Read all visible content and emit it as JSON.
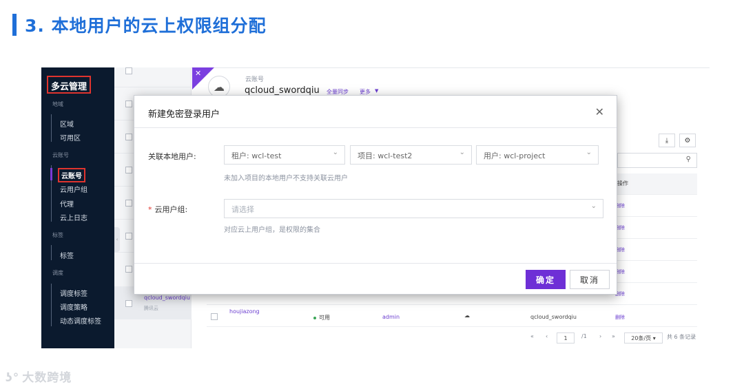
{
  "slide": {
    "title": "3. 本地用户的云上权限组分配"
  },
  "sidebar": {
    "brand": "多云管理",
    "groups": [
      {
        "label": "地域",
        "items": [
          "区域",
          "可用区"
        ]
      },
      {
        "label": "云账号",
        "items": [
          "云账号",
          "云用户组",
          "代理",
          "云上日志"
        ]
      },
      {
        "label": "标签",
        "items": [
          "标签"
        ]
      },
      {
        "label": "调度",
        "items": [
          "调度标签",
          "调度策略",
          "动态调度标签"
        ]
      }
    ]
  },
  "list_panel": {
    "selected_name": "qcloud_swordqiu",
    "selected_sub": "腾讯云"
  },
  "header": {
    "label": "云账号",
    "name": "qcloud_swordqiu",
    "link_sync": "全量同步",
    "link_more": "更多"
  },
  "table": {
    "op_header": "操作",
    "delete_label": "删除",
    "last_row": {
      "user": "houjiazong",
      "status": "可用",
      "owner": "admin",
      "account": "qcloud_swordqiu",
      "action": "删除"
    }
  },
  "pager": {
    "page": "1",
    "total_pages": "/1",
    "page_size": "20条/页",
    "total": "共 6 条记录"
  },
  "modal": {
    "title": "新建免密登录用户",
    "local_user_label": "关联本地用户:",
    "tenant": "租户: wcl-test",
    "project": "项目: wcl-test2",
    "user": "用户: wcl-project",
    "local_user_hint": "未加入项目的本地用户不支持关联云用户",
    "cloud_group_label": "云用户组:",
    "cloud_group_placeholder": "请选择",
    "cloud_group_hint": "对应云上用户组，是权限的集合",
    "ok": "确定",
    "cancel": "取消"
  },
  "watermark": "大数跨境",
  "colors": {
    "accent": "#6e2fd6",
    "title_blue": "#1f6fd8",
    "sidebar_bg": "#0b1a2e",
    "highlight_red": "#e0342e"
  }
}
